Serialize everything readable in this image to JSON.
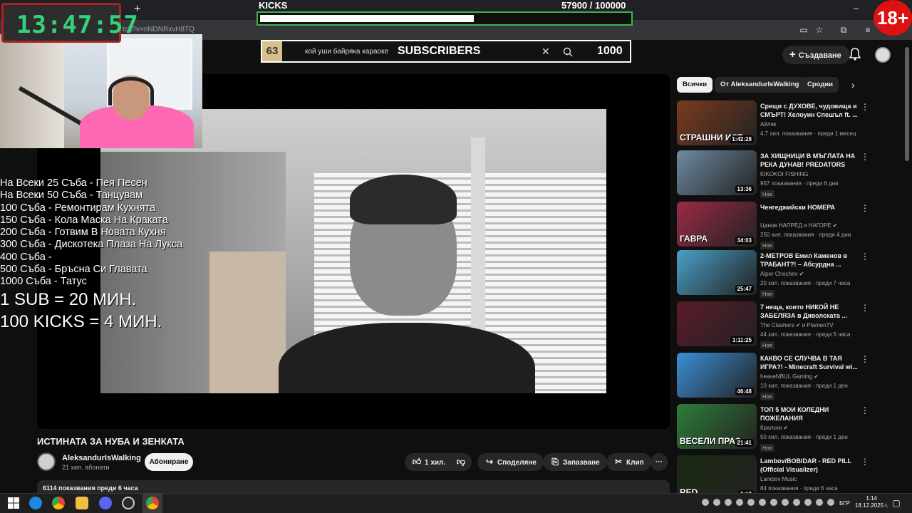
{
  "browser": {
    "new_tab": "+",
    "url": "tch?v=nNDNRxvH8TQ",
    "window_controls": [
      "–",
      "□",
      "✕"
    ]
  },
  "youtube": {
    "create_label": "Създаване",
    "video_title": "ИСТИНАТА ЗА НУБА И ЗЕНКАТА",
    "channel_name": "AleksandurIsWalking",
    "channel_subs": "21 хил. абонати",
    "subscribe_label": "Абониране",
    "likes": "1 хил.",
    "share_label": "Споделяне",
    "save_label": "Запазване",
    "clip_label": "Клип",
    "more_label": "···",
    "description_meta": "6114 показвания  преди 6 часа",
    "chips": [
      "Всички",
      "От AleksandurIsWalking",
      "Сродни"
    ],
    "recommendations": [
      {
        "title": "Срещи с ДУХОВЕ, чудовища и СМЪРТ! Хелоуин Спешъл ft. ...",
        "channel": "Айляк",
        "meta": "4,7 хил. показвания · преди 1 месец",
        "duration": "1:42:28",
        "caption": "СТРАШНИ ИСТ",
        "is_new": "",
        "color": "#7a3b1e"
      },
      {
        "title": "ЗА ХИЩНИЦИ В МЪГЛАТА НА РЕКА ДУНАВ! PREDATORS IN...",
        "channel": "KIKOKOI FISHING",
        "meta": "967 показвания · преди 6 дни",
        "duration": "13:36",
        "caption": "",
        "is_new": "Нов",
        "color": "#6f8aa3"
      },
      {
        "title": "Ченгеджийски НОМЕРА",
        "channel": "Цанов НАПРЕД и НАГОРЕ ✔",
        "meta": "250 хил. показвания · преди 4 дни",
        "duration": "34:03",
        "caption": "ГАВРА",
        "is_new": "Нов",
        "color": "#9b2a46"
      },
      {
        "title": "2-МЕТРОВ Емил Каменов в ТРАБАНТ?! – Абсурдна ...",
        "channel": "Alper Chochev ✔",
        "meta": "20 хил. показвания · преди 7 часа",
        "duration": "25:47",
        "caption": "",
        "is_new": "Нов",
        "color": "#4aa0c8"
      },
      {
        "title": "7 неща, които НИКОЙ НЕ ЗАБЕЛЯЗА в Дяволската ...",
        "channel": "The Clashers ✔ и PlamenTV",
        "meta": "44 хил. показвания · преди 5 часа",
        "duration": "1:11:25",
        "caption": "",
        "is_new": "Нов",
        "color": "#5a1a2a"
      },
      {
        "title": "КАКВО СЕ СЛУЧВА В ТАЯ ИГРА?! - Minecraft Survival wi...",
        "channel": "heaveNBUL Gaming ✔",
        "meta": "10 хил. показвания · преди 1 ден",
        "duration": "46:48",
        "caption": "",
        "is_new": "Нов",
        "color": "#3b8fd6"
      },
      {
        "title": "ТОП 5 МОИ КОЛЕДНИ ПОЖЕЛАНИЯ",
        "channel": "Кралски ✔",
        "meta": "50 хил. показвания · преди 1 ден",
        "duration": "21:41",
        "caption": "ВЕСЕЛИ ПРАЗ",
        "is_new": "Нов",
        "color": "#2e7d3a"
      },
      {
        "title": "Lambov/BOBIDAR - RED PILL (Official Visualizer)",
        "channel": "Lambov Music",
        "meta": "84 показвания · преди 6 часа",
        "duration": "3:18",
        "caption": "RED",
        "is_new": "",
        "color": "#1a2a12"
      }
    ]
  },
  "overlay": {
    "timer": "13:47:57",
    "kicks_label": "KICKS",
    "kicks_count": "57900 / 100000",
    "kicks_progress": 0.579,
    "subs_current": "63",
    "subs_title": "SUBSCRIBERS",
    "subs_goal": "1000",
    "search_query": "кой уши байряка караоке",
    "age_badge": "18+",
    "rules": [
      "На Всеки 25 Съба - Пея Песен",
      "На Всеки 50 Съба - Танцувам",
      "100 Съба - Ремонтирам Кухнята",
      "150 Съба - Кола Маска На Краката",
      "200 Съба - Готвим В Новата Кухня",
      "300 Съба - Дискотека Плаза На Лукса",
      "400 Съба -",
      "500 Съба - Бръсна Си Главата",
      "1000 Съба - Татус"
    ],
    "rule_big_1": "1 SUB = 20 МИН.",
    "rule_big_2": "100 KICKS = 4 МИН."
  },
  "taskbar": {
    "lang": "БГР",
    "time": "1:14",
    "date": "18.12.2025 г."
  },
  "colors": {
    "accent_green": "#3bb34a",
    "timer_green": "#34d27a",
    "age_red": "#dd1111",
    "cam_shirt": "#ff69b4"
  }
}
